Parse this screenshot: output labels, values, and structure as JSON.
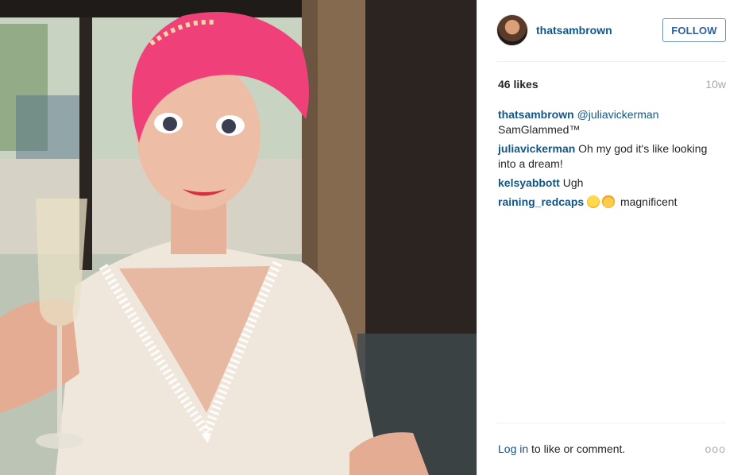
{
  "post": {
    "owner_username": "thatsambrown",
    "follow_label": "FOLLOW",
    "likes": "46 likes",
    "age": "10w"
  },
  "caption": {
    "user": "thatsambrown",
    "mention": "@juliavickerman",
    "text": "SamGlammed™"
  },
  "comments": [
    {
      "user": "juliavickerman",
      "text": "Oh my god it's like looking into a dream!"
    },
    {
      "user": "kelsyabbott",
      "text": "Ugh"
    },
    {
      "user": "raining_redcaps",
      "emojis": [
        "kissing-face-icon",
        "ok-hand-icon"
      ],
      "text": "magnificent"
    }
  ],
  "footer": {
    "login_link": "Log in",
    "login_text": " to like or comment.",
    "more_label": "ooo"
  },
  "colors": {
    "link_blue": "#125688",
    "hair_pink": "#f0407a",
    "divider": "#efefef"
  },
  "icons": {
    "photo": "portrait-photo",
    "more": "more-options-icon"
  }
}
